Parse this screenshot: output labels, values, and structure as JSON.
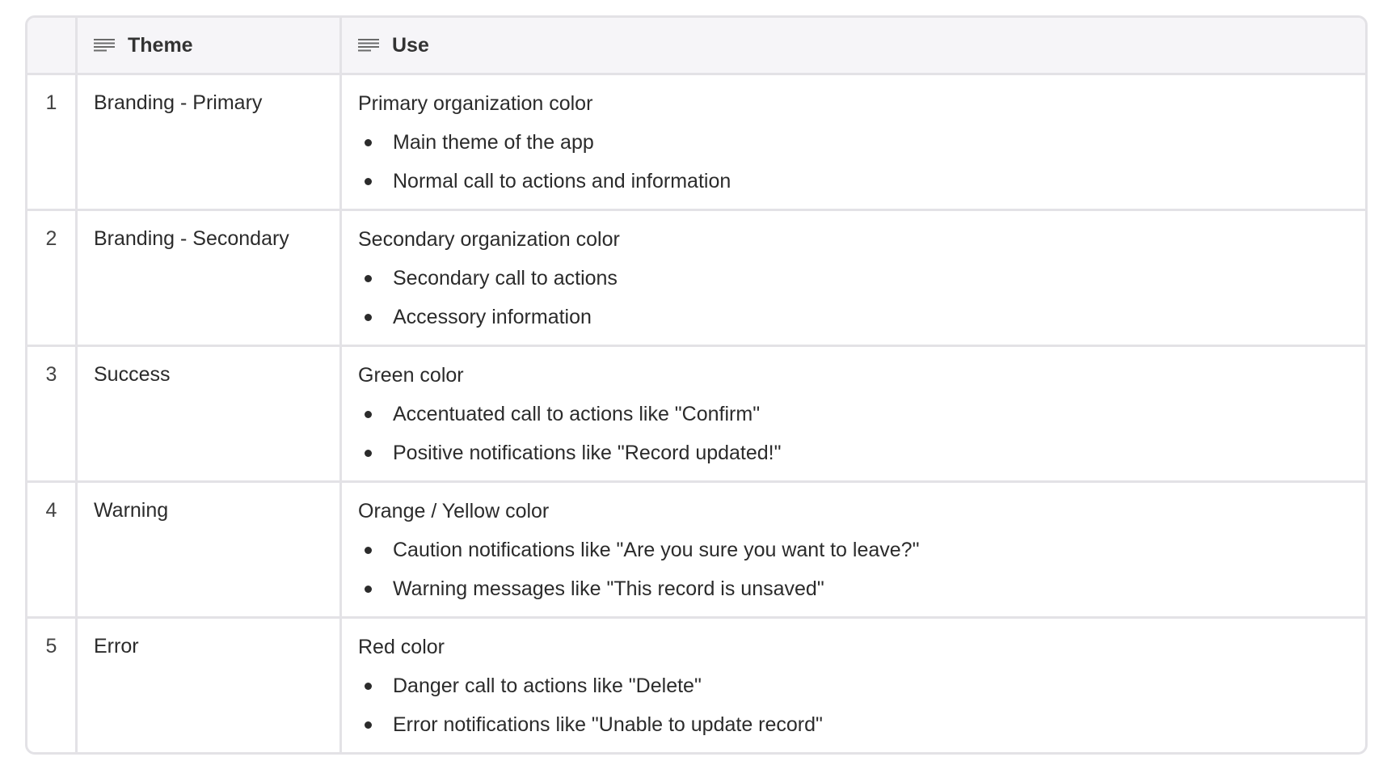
{
  "table": {
    "headers": {
      "theme": "Theme",
      "use": "Use",
      "column_icon": "text-lines-icon"
    },
    "rows": [
      {
        "index": "1",
        "theme": "Branding - Primary",
        "use_title": "Primary organization color",
        "bullets": [
          "Main theme of the app",
          "Normal call to actions and information"
        ]
      },
      {
        "index": "2",
        "theme": "Branding - Secondary",
        "use_title": "Secondary organization color",
        "bullets": [
          "Secondary call to actions",
          "Accessory information"
        ]
      },
      {
        "index": "3",
        "theme": "Success",
        "use_title": "Green color",
        "bullets": [
          "Accentuated call to actions like \"Confirm\"",
          "Positive notifications like \"Record updated!\""
        ]
      },
      {
        "index": "4",
        "theme": "Warning",
        "use_title": "Orange / Yellow color",
        "bullets": [
          "Caution notifications like \"Are you sure you want to leave?\"",
          "Warning messages like \"This record is unsaved\""
        ]
      },
      {
        "index": "5",
        "theme": "Error",
        "use_title": "Red color",
        "bullets": [
          "Danger call to actions like \"Delete\"",
          "Error notifications like \"Unable to update record\""
        ]
      }
    ]
  },
  "colors": {
    "border": "#e3e2e6",
    "header_bg": "#f6f5f8",
    "text": "#2b2b2b"
  }
}
